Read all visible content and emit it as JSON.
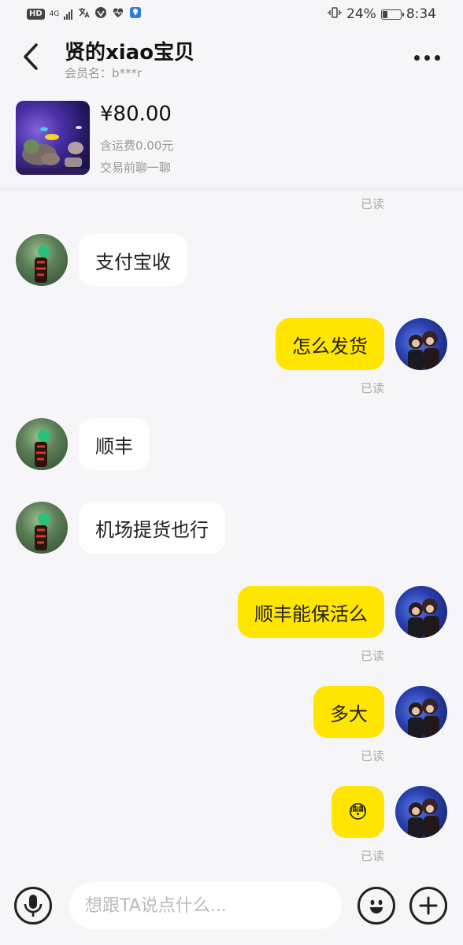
{
  "status_bar": {
    "hd": "HD",
    "network": "4G",
    "battery": "24%",
    "time": "8:34"
  },
  "header": {
    "title": "贤的xiao宝贝",
    "subtitle": "会员名：b***r",
    "back_icon": "chevron-left-icon",
    "more_icon": "more-dots-icon"
  },
  "product": {
    "price": "¥80.00",
    "shipping": "含运费0.00元",
    "note": "交易前聊一聊"
  },
  "messages": [
    {
      "sender": "seller",
      "text": "支付宝收"
    },
    {
      "sender": "me",
      "text": "怎么发货",
      "status": "已读"
    },
    {
      "sender": "seller",
      "text": "顺丰"
    },
    {
      "sender": "seller",
      "text": "机场提货也行"
    },
    {
      "sender": "me",
      "text": "顺丰能保活么",
      "status": "已读"
    },
    {
      "sender": "me",
      "text": "多大",
      "status": "已读"
    },
    {
      "sender": "me",
      "text": "😳",
      "status": "已读"
    }
  ],
  "top_read_status": "已读",
  "input": {
    "placeholder": "想跟TA说点什么..."
  },
  "colors": {
    "my_bubble": "#ffe500",
    "their_bubble": "#ffffff",
    "background": "#f6f6f8"
  }
}
